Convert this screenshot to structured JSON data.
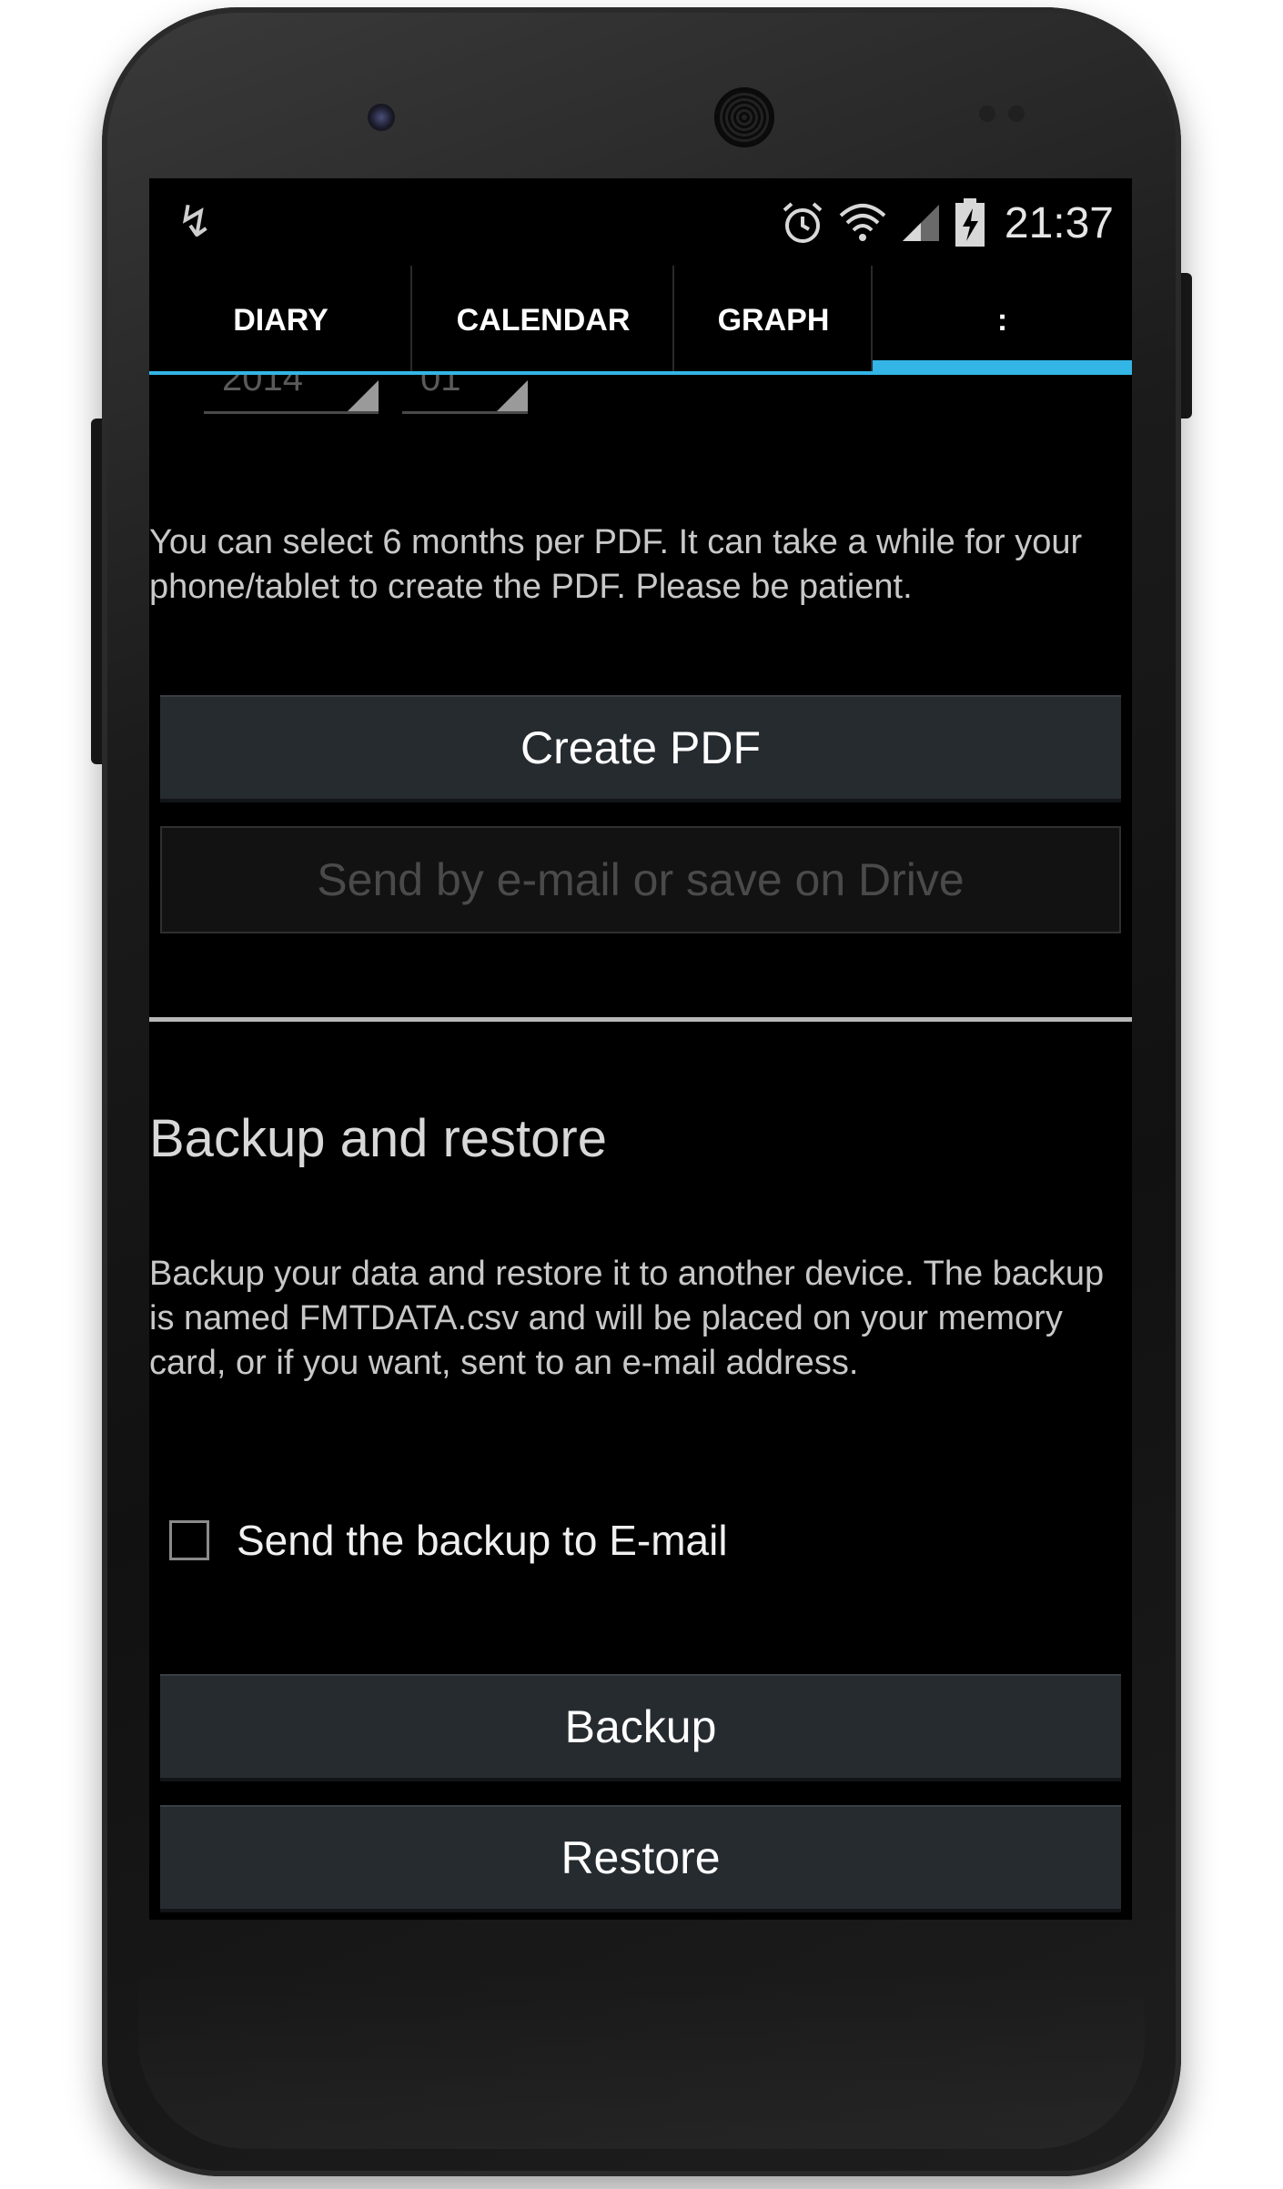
{
  "status_bar": {
    "time": "21:37",
    "icons": [
      "usb-icon",
      "alarm-icon",
      "wifi-icon",
      "cell-signal-icon",
      "battery-charging-icon"
    ]
  },
  "tabs": [
    {
      "label": "DIARY",
      "active": false
    },
    {
      "label": "CALENDAR",
      "active": false
    },
    {
      "label": "GRAPH",
      "active": false
    },
    {
      "label": ":",
      "active": true
    }
  ],
  "pdf": {
    "year_value": "2014",
    "month_value": "01",
    "info_text": "You can select 6 months per PDF. It can take a while for your phone/tablet to create the PDF. Please be patient.",
    "create_button": "Create PDF",
    "send_button": "Send by e-mail or save on Drive"
  },
  "backup": {
    "title": "Backup and restore",
    "description": "Backup your data and restore it to another device. The backup is named FMTDATA.csv and will be placed on your memory card, or if you want, sent to an e-mail address.",
    "email_checkbox_label": "Send the backup to E-mail",
    "email_checkbox_checked": false,
    "backup_button": "Backup",
    "restore_button": "Restore"
  },
  "colors": {
    "accent": "#33b5e5",
    "background": "#000000",
    "button": "#262b30"
  }
}
